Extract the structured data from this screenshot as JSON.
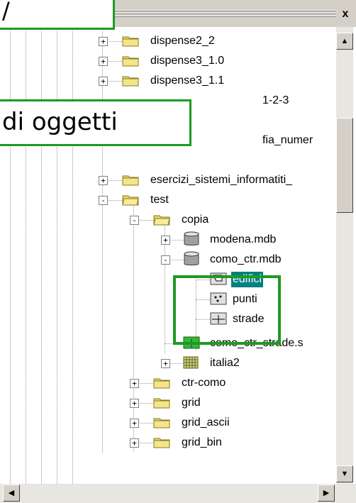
{
  "window": {
    "close_glyph": "x"
  },
  "callouts": {
    "top_partial": "/",
    "middle": "di oggetti"
  },
  "tree": [
    {
      "label": "dispense2_2",
      "icon": "folder-icon",
      "expander": "+"
    },
    {
      "label": "dispense3_1.0",
      "icon": "folder-icon",
      "expander": "+"
    },
    {
      "label": "dispense3_1.1",
      "icon": "folder-icon",
      "expander": "+"
    },
    {
      "label": "1-2-3",
      "icon": "folder-icon",
      "expander": "+"
    },
    {
      "label": "fia_numer",
      "icon": "folder-icon",
      "expander": "+"
    },
    {
      "label": "esercizi_sistemi_informatiti_",
      "icon": "folder-icon",
      "expander": "+"
    },
    {
      "label": "test",
      "icon": "folder-open-icon",
      "expander": "-"
    },
    {
      "label": "copia",
      "icon": "folder-open-icon",
      "expander": "-"
    },
    {
      "label": "modena.mdb",
      "icon": "database-icon",
      "expander": "+"
    },
    {
      "label": "como_ctr.mdb",
      "icon": "database-icon",
      "expander": "-"
    },
    {
      "label": "edifici",
      "icon": "polygon-featureclass-icon",
      "selected": true
    },
    {
      "label": "punti",
      "icon": "point-featureclass-icon"
    },
    {
      "label": "strade",
      "icon": "line-featureclass-icon"
    },
    {
      "label": "como_ctr_strade.s",
      "icon": "shapefile-icon"
    },
    {
      "label": "italia2",
      "icon": "raster-icon",
      "expander": "+"
    },
    {
      "label": "ctr-como",
      "icon": "folder-icon",
      "expander": "+"
    },
    {
      "label": "grid",
      "icon": "folder-icon",
      "expander": "+"
    },
    {
      "label": "grid_ascii",
      "icon": "folder-icon",
      "expander": "+"
    },
    {
      "label": "grid_bin",
      "icon": "folder-icon",
      "expander": "+"
    }
  ],
  "scrollbars": {
    "up_arrow": "▲",
    "down_arrow": "▼",
    "left_arrow": "◀",
    "right_arrow": "▶"
  },
  "colors": {
    "accent": "#1e9a22",
    "selection": "#008080",
    "folder": "#e8d46a"
  }
}
